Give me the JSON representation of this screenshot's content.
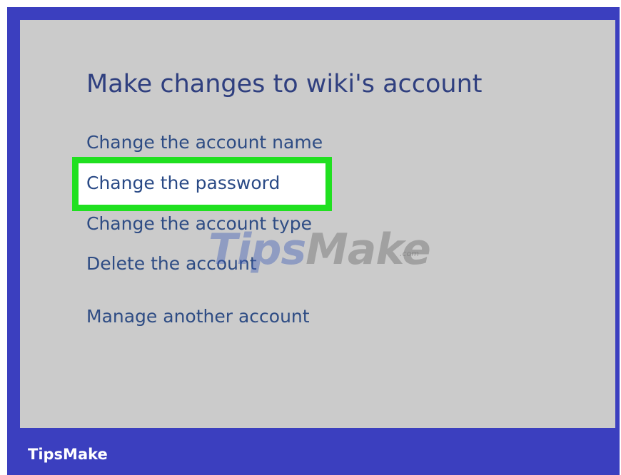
{
  "page": {
    "title": "Make changes to wiki's account"
  },
  "links": [
    {
      "label": "Change the account name"
    },
    {
      "label": "Change the password"
    },
    {
      "label": "Change the account type"
    },
    {
      "label": "Delete the account"
    },
    {
      "label": "Manage another account"
    }
  ],
  "watermark": {
    "part1": "Tips",
    "part2": "Make",
    "suffix": ".com"
  },
  "brand": {
    "name": "TipsMake"
  },
  "colors": {
    "frame": "#3b3fbf",
    "panel": "#cbcbcb",
    "highlight": "#20e020",
    "link": "#2e4c84"
  }
}
